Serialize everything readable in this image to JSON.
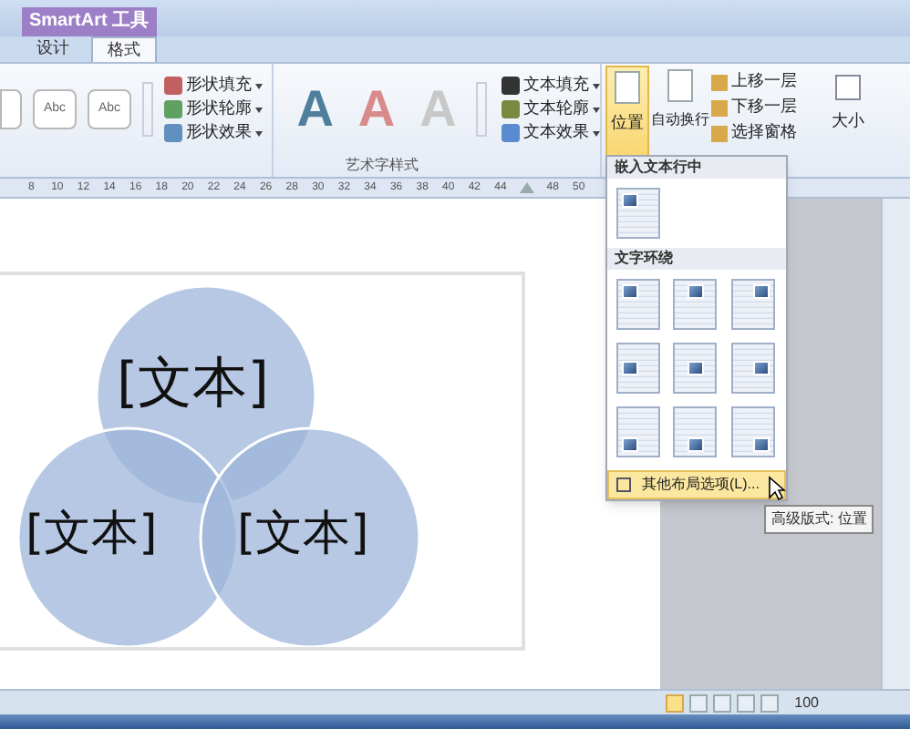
{
  "window": {
    "context_tab": "SmartArt 工具"
  },
  "tabs": [
    {
      "label": "设计",
      "selected": false
    },
    {
      "label": "格式",
      "selected": true
    }
  ],
  "ribbon": {
    "shape_styles": [
      {
        "label": "Abc"
      },
      {
        "label": "Abc"
      }
    ],
    "shape_buttons": [
      "形状填充",
      "形状轮廓",
      "形状效果"
    ],
    "wordart_styles": [
      {
        "label": "A",
        "color": "#4f7f9c"
      },
      {
        "label": "A",
        "color": "#d98a8a"
      },
      {
        "label": "A",
        "color": "#c8c8c8"
      }
    ],
    "text_buttons": [
      "文本填充",
      "文本轮廓",
      "文本效果"
    ],
    "wordart_group": "艺术字样式",
    "position": {
      "label": "位置",
      "selected": true
    },
    "wrap": "自动换行",
    "arrange": [
      "上移一层",
      "下移一层",
      "选择窗格"
    ],
    "size": "大小"
  },
  "ruler": [
    {
      "label": "8"
    },
    {
      "label": "10"
    },
    {
      "label": "12"
    },
    {
      "label": "14"
    },
    {
      "label": "16"
    },
    {
      "label": "18"
    },
    {
      "label": "20"
    },
    {
      "label": "22"
    },
    {
      "label": "24"
    },
    {
      "label": "26"
    },
    {
      "label": "28"
    },
    {
      "label": "30"
    },
    {
      "label": "32"
    },
    {
      "label": "34"
    },
    {
      "label": "36"
    },
    {
      "label": "38"
    },
    {
      "label": "40"
    },
    {
      "label": "42"
    },
    {
      "label": "44"
    },
    {
      "kind": "marker"
    },
    {
      "label": "48"
    },
    {
      "label": "50"
    }
  ],
  "diagram": [
    {
      "text": "[文本]"
    },
    {
      "text": "[文本]"
    },
    {
      "text": "[文本]"
    }
  ],
  "menu": {
    "sections": [
      {
        "title": "嵌入文本行中",
        "options": [
          {
            "kind": "inline"
          }
        ]
      },
      {
        "title": "文字环绕",
        "options": [
          {
            "kind": "nw"
          },
          {
            "kind": "n"
          },
          {
            "kind": "ne"
          },
          {
            "kind": "w"
          },
          {
            "kind": "c"
          },
          {
            "kind": "e"
          },
          {
            "kind": "sw"
          },
          {
            "kind": "s"
          },
          {
            "kind": "se"
          }
        ]
      }
    ],
    "more_options": {
      "label": "其他布局选项(L)...",
      "hover": true
    }
  },
  "tooltip": "高级版式: 位置",
  "status_bar": {
    "views": [
      {
        "selected": true
      },
      {
        "selected": false
      },
      {
        "selected": false
      },
      {
        "selected": false
      },
      {
        "selected": false
      }
    ],
    "zoom": "100"
  }
}
